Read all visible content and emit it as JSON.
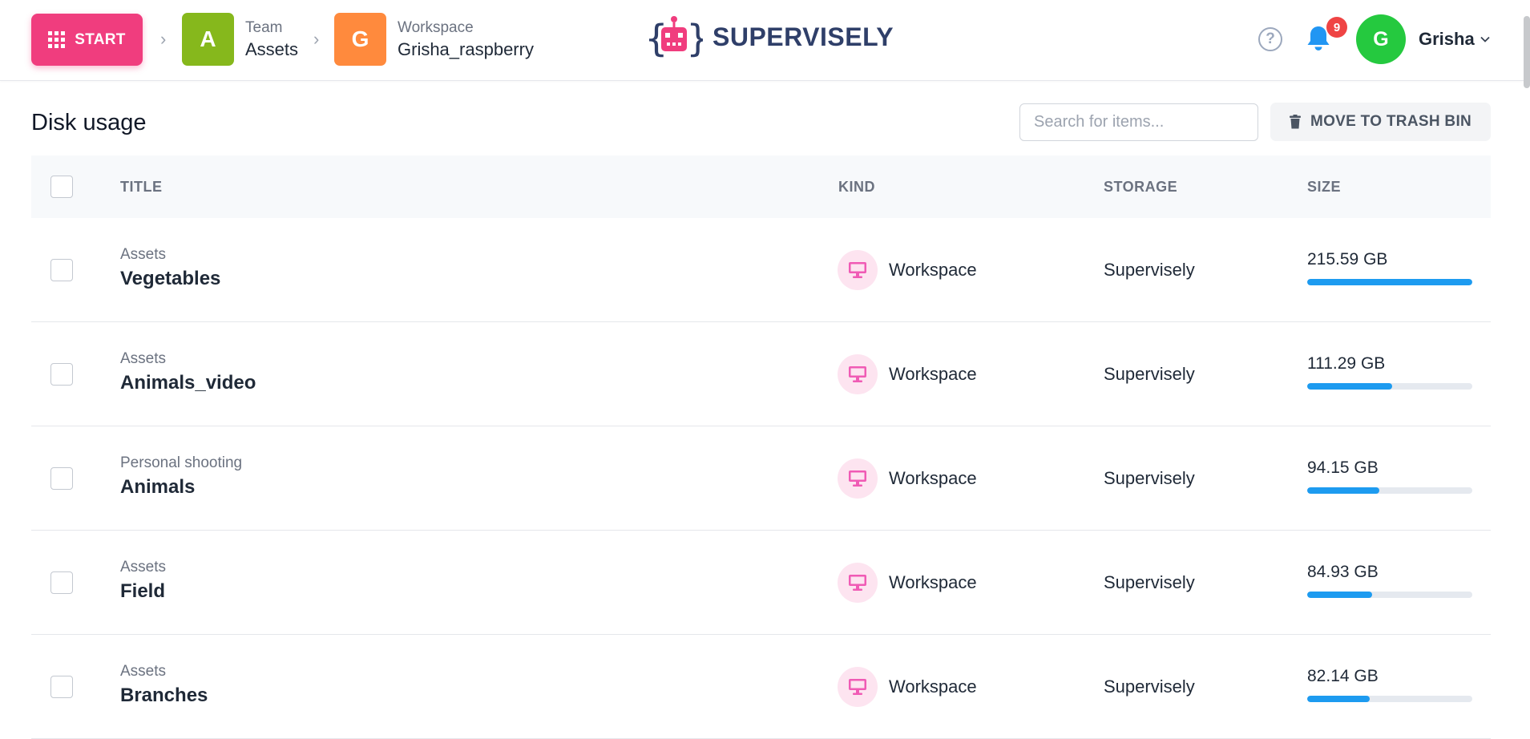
{
  "header": {
    "start_label": "START",
    "breadcrumb": [
      {
        "initial": "A",
        "caption": "Team",
        "value": "Assets",
        "color": "#86b81c"
      },
      {
        "initial": "G",
        "caption": "Workspace",
        "value": "Grisha_raspberry",
        "color": "#ff8a3d"
      }
    ],
    "logo_text": "SUPERVISELY",
    "help_icon": "question-circle-icon",
    "notifications_count": "9",
    "user": {
      "initial": "G",
      "name": "Grisha"
    }
  },
  "page": {
    "title": "Disk usage",
    "search_placeholder": "Search for items...",
    "search_value": "",
    "trash_button_label": "MOVE TO TRASH BIN"
  },
  "table": {
    "columns": {
      "title": "TITLE",
      "kind": "KIND",
      "storage": "STORAGE",
      "size": "SIZE"
    },
    "rows": [
      {
        "parent": "Assets",
        "title": "Vegetables",
        "kind": "Workspace",
        "storage": "Supervisely",
        "size": "215.59 GB",
        "usage_fraction": 1.0
      },
      {
        "parent": "Assets",
        "title": "Animals_video",
        "kind": "Workspace",
        "storage": "Supervisely",
        "size": "111.29 GB",
        "usage_fraction": 0.516
      },
      {
        "parent": "Personal shooting",
        "title": "Animals",
        "kind": "Workspace",
        "storage": "Supervisely",
        "size": "94.15 GB",
        "usage_fraction": 0.437
      },
      {
        "parent": "Assets",
        "title": "Field",
        "kind": "Workspace",
        "storage": "Supervisely",
        "size": "84.93 GB",
        "usage_fraction": 0.394
      },
      {
        "parent": "Assets",
        "title": "Branches",
        "kind": "Workspace",
        "storage": "Supervisely",
        "size": "82.14 GB",
        "usage_fraction": 0.381
      }
    ]
  },
  "colors": {
    "accent": "#f03d7e",
    "progress": "#1d9bf0",
    "kind_icon": "#f05bb5"
  }
}
